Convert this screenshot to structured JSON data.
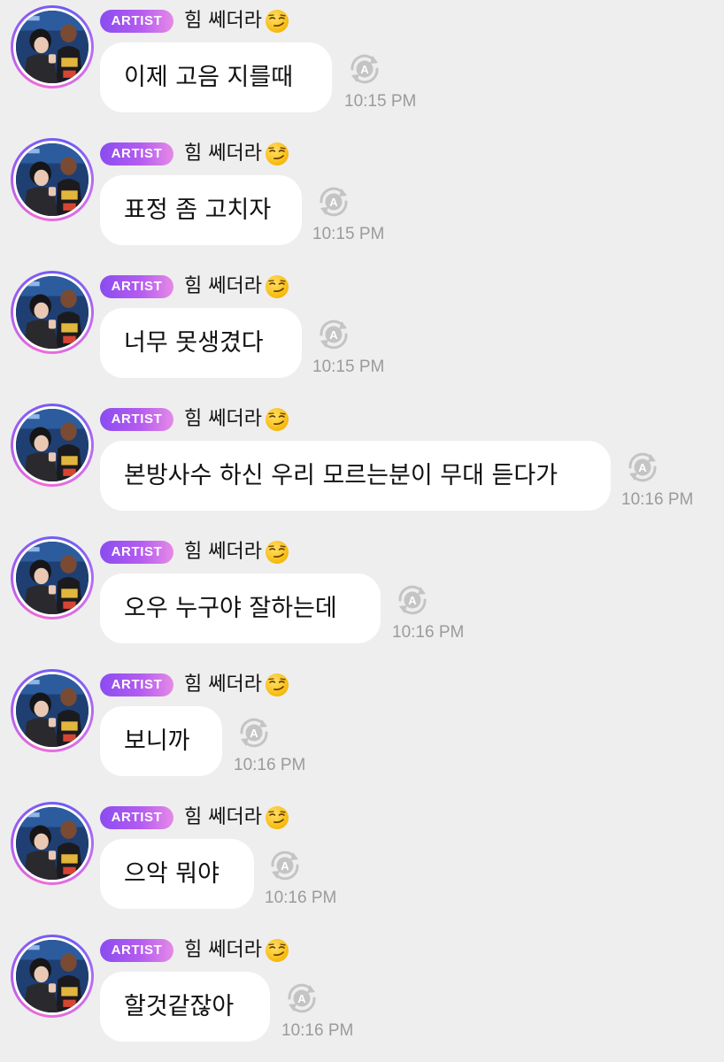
{
  "sender": {
    "badge": "ARTIST",
    "name": "힘 쎄더라",
    "emoji": "smirking-face-emoji"
  },
  "colors": {
    "background": "#eeeeef",
    "bubble": "#ffffff",
    "badge_gradient": [
      "#8a4cf0",
      "#e58ae6"
    ],
    "timestamp": "#9b9b9b",
    "translate_icon": "#c4c4c4"
  },
  "messages": [
    {
      "text": "이제 고음 지를때",
      "time": "10:15 PM"
    },
    {
      "text": "표정 좀 고치자",
      "time": "10:15 PM"
    },
    {
      "text": "너무 못생겼다",
      "time": "10:15 PM"
    },
    {
      "text": "본방사수 하신 우리 모르는분이 무대 듣다가",
      "time": "10:16 PM"
    },
    {
      "text": "오우 누구야 잘하는데",
      "time": "10:16 PM"
    },
    {
      "text": "보니까",
      "time": "10:16 PM"
    },
    {
      "text": "으악 뭐야",
      "time": "10:16 PM"
    },
    {
      "text": "할것같잖아",
      "time": "10:16 PM"
    }
  ]
}
